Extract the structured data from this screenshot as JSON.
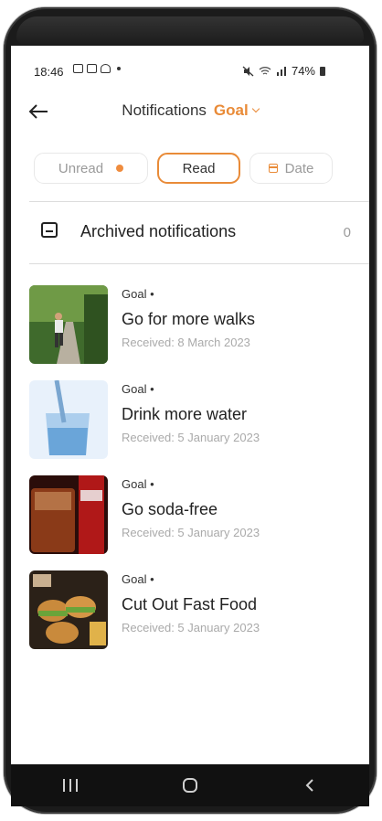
{
  "status_bar": {
    "time": "18:46",
    "battery": "74%"
  },
  "header": {
    "title": "Notifications",
    "category": "Goal"
  },
  "filters": {
    "unread": "Unread",
    "read": "Read",
    "date": "Date"
  },
  "archived": {
    "label": "Archived notifications",
    "count": "0"
  },
  "notifications": [
    {
      "category": "Goal •",
      "title": "Go for more walks",
      "received": "Received: 8 March 2023",
      "image": "person-running-photo"
    },
    {
      "category": "Goal •",
      "title": "Drink more water",
      "received": "Received: 5 January 2023",
      "image": "water-glass-photo"
    },
    {
      "category": "Goal •",
      "title": "Go soda-free",
      "received": "Received: 5 January 2023",
      "image": "soda-photo"
    },
    {
      "category": "Goal •",
      "title": "Cut Out Fast Food",
      "received": "Received: 5 January 2023",
      "image": "burgers-photo"
    }
  ],
  "colors": {
    "accent": "#e98b38",
    "unread_dot": "#ef8c3e"
  }
}
